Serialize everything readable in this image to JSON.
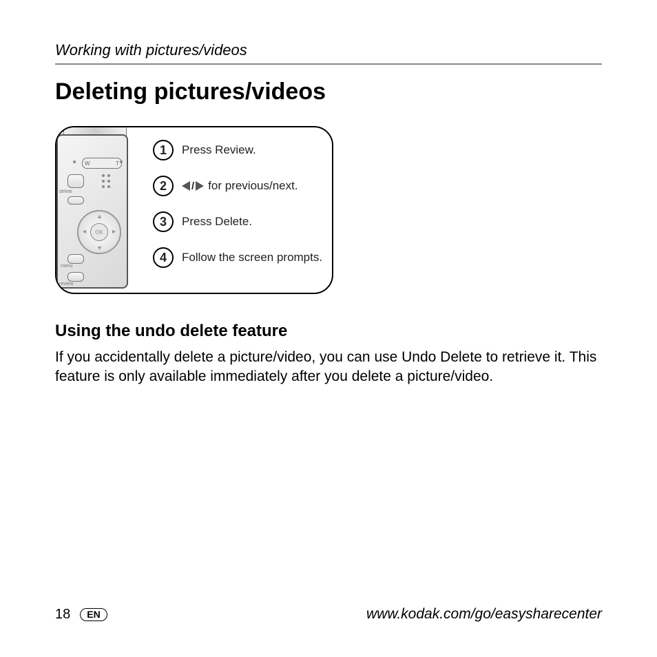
{
  "chapter": "Working with pictures/videos",
  "title": "Deleting pictures/videos",
  "steps": [
    {
      "num": "1",
      "text": "Press Review."
    },
    {
      "num": "2",
      "text": "for previous/next.",
      "hasNavArrows": true
    },
    {
      "num": "3",
      "text": "Press Delete."
    },
    {
      "num": "4",
      "text": "Follow the screen prompts."
    }
  ],
  "camera": {
    "labels": {
      "delete": "delete",
      "menu": "menu",
      "review": "review",
      "ok": "OK",
      "zoomW": "W",
      "zoomT": "T"
    }
  },
  "subhead": "Using the undo delete feature",
  "body": "If you accidentally delete a picture/video, you can use Undo Delete to retrieve it. This feature is only available immediately after you delete a picture/video.",
  "footer": {
    "pageNumber": "18",
    "lang": "EN",
    "url": "www.kodak.com/go/easysharecenter"
  }
}
